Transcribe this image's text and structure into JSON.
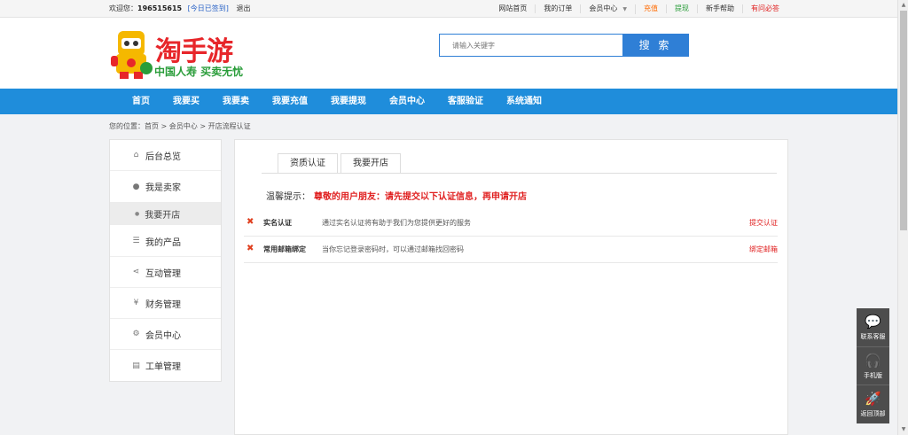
{
  "topbar": {
    "welcome": "欢迎您：",
    "username": "196515615",
    "signed": "[今日已签到]",
    "logout": "退出",
    "links": [
      {
        "label": "网站首页",
        "color": "normal"
      },
      {
        "label": "我的订单",
        "color": "normal"
      },
      {
        "label": "会员中心",
        "color": "normal"
      },
      {
        "label": "充值",
        "color": "orange"
      },
      {
        "label": "提现",
        "color": "green"
      },
      {
        "label": "新手帮助",
        "color": "normal"
      },
      {
        "label": "有问必答",
        "color": "red"
      }
    ]
  },
  "header": {
    "brand": "淘手游",
    "slogan": "中国人寿 买卖无忧",
    "search_placeholder": "请输入关键字",
    "search_button": "搜 索"
  },
  "nav": {
    "items": [
      "首页",
      "我要买",
      "我要卖",
      "我要充值",
      "我要提现",
      "会员中心",
      "客服验证",
      "系统通知"
    ]
  },
  "breadcrumb": "您的位置：首页 > 会员中心 > 开店流程认证",
  "sidebar": {
    "items": [
      {
        "label": "后台总览",
        "icon": "home-icon"
      },
      {
        "label": "我是卖家",
        "icon": "user-icon"
      },
      {
        "label": "我要开店",
        "icon": "dot-icon",
        "sub": true
      },
      {
        "label": "我的产品",
        "icon": "list-icon"
      },
      {
        "label": "互动管理",
        "icon": "share-icon"
      },
      {
        "label": "财务管理",
        "icon": "yen-icon"
      },
      {
        "label": "会员中心",
        "icon": "gears-icon"
      },
      {
        "label": "工单管理",
        "icon": "clipboard-icon"
      }
    ]
  },
  "content": {
    "tabs": [
      "资质认证",
      "我要开店"
    ],
    "tip_label": "温馨提示：",
    "tip_message": "尊敬的用户朋友：请先提交以下认证信息，再申请开店",
    "rows": [
      {
        "title": "实名认证",
        "desc": "通过实名认证将有助于我们为您提供更好的服务",
        "action": "提交认证"
      },
      {
        "title": "常用邮箱绑定",
        "desc": "当你忘记登录密码时，可以通过邮箱找回密码",
        "action": "绑定邮箱"
      }
    ]
  },
  "float_widget": {
    "items": [
      {
        "label": "联系客服",
        "icon": "chat-icon"
      },
      {
        "label": "手机版",
        "icon": "headset-icon"
      },
      {
        "label": "返回顶部",
        "icon": "rocket-icon"
      }
    ]
  }
}
